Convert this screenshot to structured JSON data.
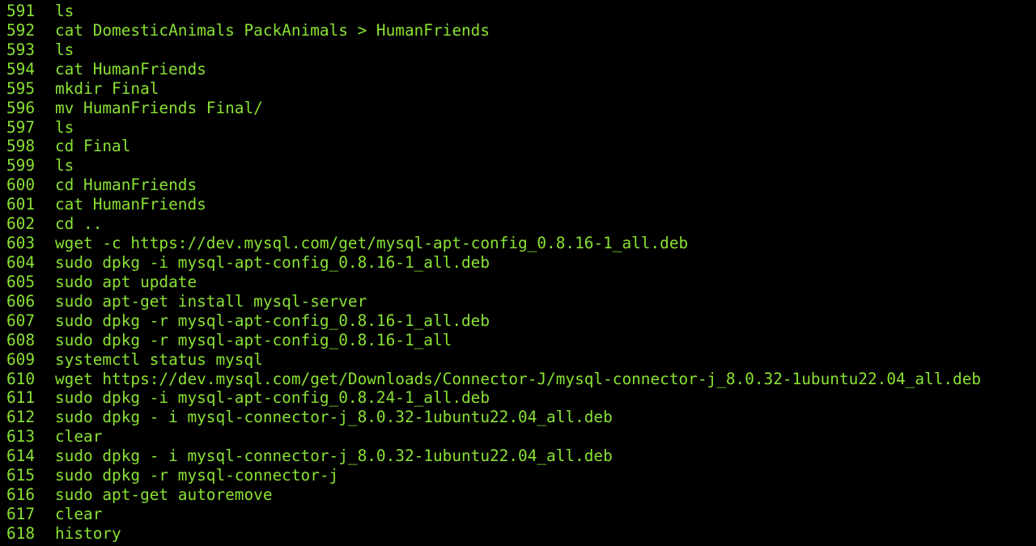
{
  "colors": {
    "background": "#000000",
    "text": "#8ae234"
  },
  "history": [
    {
      "num": "591",
      "cmd": "ls"
    },
    {
      "num": "592",
      "cmd": "cat DomesticAnimals PackAnimals > HumanFriends"
    },
    {
      "num": "593",
      "cmd": "ls"
    },
    {
      "num": "594",
      "cmd": "cat HumanFriends"
    },
    {
      "num": "595",
      "cmd": "mkdir Final"
    },
    {
      "num": "596",
      "cmd": "mv HumanFriends Final/"
    },
    {
      "num": "597",
      "cmd": "ls"
    },
    {
      "num": "598",
      "cmd": "cd Final"
    },
    {
      "num": "599",
      "cmd": "ls"
    },
    {
      "num": "600",
      "cmd": "cd HumanFriends"
    },
    {
      "num": "601",
      "cmd": "cat HumanFriends"
    },
    {
      "num": "602",
      "cmd": "cd .."
    },
    {
      "num": "603",
      "cmd": "wget -c https://dev.mysql.com/get/mysql-apt-config_0.8.16-1_all.deb"
    },
    {
      "num": "604",
      "cmd": "sudo dpkg -i mysql-apt-config_0.8.16-1_all.deb"
    },
    {
      "num": "605",
      "cmd": "sudo apt update"
    },
    {
      "num": "606",
      "cmd": "sudo apt-get install mysql-server"
    },
    {
      "num": "607",
      "cmd": "sudo dpkg -r mysql-apt-config_0.8.16-1_all.deb"
    },
    {
      "num": "608",
      "cmd": "sudo dpkg -r mysql-apt-config_0.8.16-1_all"
    },
    {
      "num": "609",
      "cmd": "systemctl status mysql"
    },
    {
      "num": "610",
      "cmd": "wget https://dev.mysql.com/get/Downloads/Connector-J/mysql-connector-j_8.0.32-1ubuntu22.04_all.deb"
    },
    {
      "num": "611",
      "cmd": "sudo dpkg -i mysql-apt-config_0.8.24-1_all.deb"
    },
    {
      "num": "612",
      "cmd": "sudo dpkg - i mysql-connector-j_8.0.32-1ubuntu22.04_all.deb"
    },
    {
      "num": "613",
      "cmd": "clear"
    },
    {
      "num": "614",
      "cmd": "sudo dpkg - i mysql-connector-j_8.0.32-1ubuntu22.04_all.deb"
    },
    {
      "num": "615",
      "cmd": "sudo dpkg -r mysql-connector-j"
    },
    {
      "num": "616",
      "cmd": "sudo apt-get autoremove"
    },
    {
      "num": "617",
      "cmd": "clear"
    },
    {
      "num": "618",
      "cmd": "history"
    }
  ]
}
